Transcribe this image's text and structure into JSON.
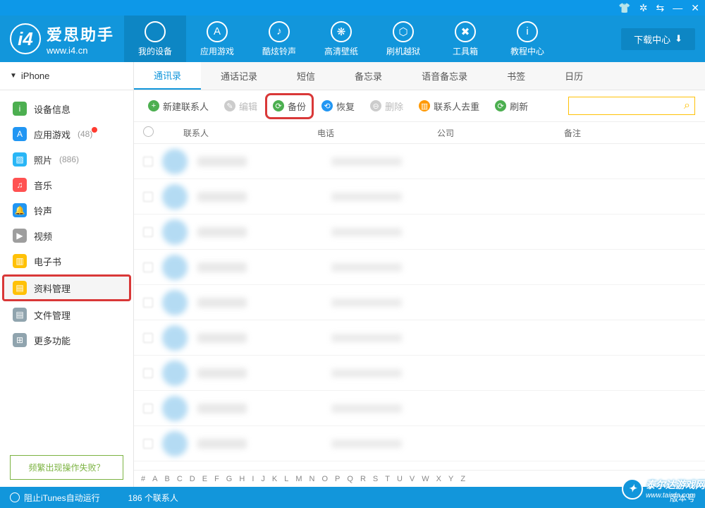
{
  "titlebar": {
    "icons": [
      "👕",
      "⚙",
      "⇄",
      "—",
      "✕"
    ]
  },
  "logo": {
    "cn": "爱思助手",
    "url": "www.i4.cn"
  },
  "nav": [
    {
      "label": "我的设备",
      "icon": "",
      "active": true
    },
    {
      "label": "应用游戏",
      "icon": "A"
    },
    {
      "label": "酷炫铃声",
      "icon": "♪"
    },
    {
      "label": "高清壁纸",
      "icon": "❋"
    },
    {
      "label": "刷机越狱",
      "icon": "⬡"
    },
    {
      "label": "工具箱",
      "icon": "✖"
    },
    {
      "label": "教程中心",
      "icon": "i"
    }
  ],
  "download_center": "下载中心",
  "device_selector": "iPhone",
  "sidebar": [
    {
      "label": "设备信息",
      "color": "#4caf50",
      "icon": "i"
    },
    {
      "label": "应用游戏",
      "color": "#2196f3",
      "icon": "A",
      "count": "(48)",
      "dot": true
    },
    {
      "label": "照片",
      "color": "#29b6f6",
      "icon": "▨",
      "count": "(886)"
    },
    {
      "label": "音乐",
      "color": "#ff5252",
      "icon": "♫"
    },
    {
      "label": "铃声",
      "color": "#2196f3",
      "icon": "🔔"
    },
    {
      "label": "视频",
      "color": "#9e9e9e",
      "icon": "▶"
    },
    {
      "label": "电子书",
      "color": "#ffc107",
      "icon": "▥"
    },
    {
      "label": "资料管理",
      "color": "#ffc107",
      "icon": "▤",
      "highlighted": true
    },
    {
      "label": "文件管理",
      "color": "#90a4ae",
      "icon": "▤"
    },
    {
      "label": "更多功能",
      "color": "#90a4ae",
      "icon": "⊞"
    }
  ],
  "help_link": "频繁出现操作失败？",
  "tabs": [
    "通讯录",
    "通话记录",
    "短信",
    "备忘录",
    "语音备忘录",
    "书签",
    "日历"
  ],
  "active_tab": 0,
  "toolbar": [
    {
      "label": "新建联系人",
      "color": "#4caf50",
      "icon": "+"
    },
    {
      "label": "编辑",
      "color": "#ccc",
      "icon": "✎",
      "disabled": true
    },
    {
      "label": "备份",
      "color": "#4caf50",
      "icon": "⟳",
      "highlighted": true
    },
    {
      "label": "恢复",
      "color": "#2196f3",
      "icon": "⟲"
    },
    {
      "label": "删除",
      "color": "#ccc",
      "icon": "⊖",
      "disabled": true
    },
    {
      "label": "联系人去重",
      "color": "#ff9800",
      "icon": "▥"
    },
    {
      "label": "刷新",
      "color": "#4caf50",
      "icon": "⟳"
    }
  ],
  "columns": {
    "contact": "联系人",
    "phone": "电话",
    "company": "公司",
    "note": "备注"
  },
  "row_count": 9,
  "alpha": [
    "#",
    "A",
    "B",
    "C",
    "D",
    "E",
    "F",
    "G",
    "H",
    "I",
    "J",
    "K",
    "L",
    "M",
    "N",
    "O",
    "P",
    "Q",
    "R",
    "S",
    "T",
    "U",
    "V",
    "W",
    "X",
    "Y",
    "Z"
  ],
  "status": {
    "itunes": "阻止iTunes自动运行",
    "count": "186 个联系人",
    "version": "版本号"
  },
  "watermark": {
    "name": "泰尔达游戏网",
    "url": "www.tairda.com"
  }
}
